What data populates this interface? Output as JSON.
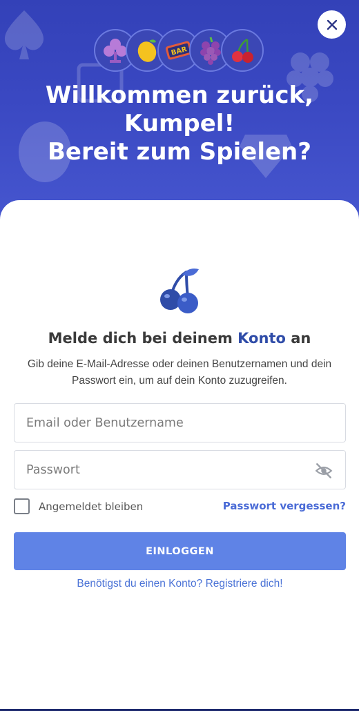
{
  "header": {
    "icons": [
      "clover-icon",
      "lemon-icon",
      "bar-icon",
      "grapes-icon",
      "cherry-icon"
    ],
    "bar_text": "BAR",
    "welcome_lines": [
      "Willkommen zurück,",
      "Kumpel!",
      "Bereit zum Spielen?"
    ],
    "close_icon": "close-icon"
  },
  "login": {
    "title_prefix": "Melde dich bei deinem",
    "title_accent": "Konto",
    "title_suffix": "an",
    "description": "Gib deine E-Mail-Adresse oder deinen Benutzernamen und dein Passwort ein, um auf dein Konto zuzugreifen.",
    "username_placeholder": "Email oder Benutzername",
    "username_value": "",
    "password_placeholder": "Passwort",
    "password_value": "",
    "password_toggle_icon": "eye-off-icon",
    "remember_label": "Angemeldet bleiben",
    "remember_checked": false,
    "forgot_link": "Passwort vergessen?",
    "submit_label": "EINLOGGEN",
    "register_link": "Benötigst du einen Konto? Registriere dich!"
  },
  "colors": {
    "header_bg": "#3a48c2",
    "accent": "#2f4ca8",
    "button": "#5f83e6",
    "link": "#4a6bd6"
  }
}
